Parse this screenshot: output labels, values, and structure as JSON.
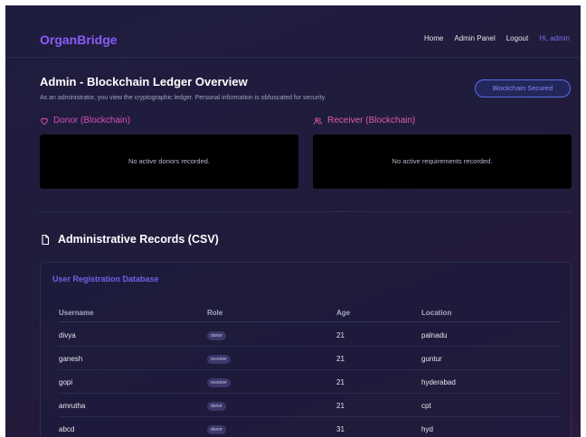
{
  "nav": {
    "brand": "OrganBridge",
    "links": [
      "Home",
      "Admin Panel",
      "Logout"
    ],
    "greeting": "Hi, admin"
  },
  "header": {
    "title": "Admin - Blockchain Ledger Overview",
    "subtitle": "As an administrator, you view the cryptographic ledger. Personal information is obfuscated for security.",
    "badge": "Blockchain Secured"
  },
  "donor": {
    "title": "Donor (Blockchain)",
    "empty": "No active donors recorded."
  },
  "receiver": {
    "title": "Receiver (Blockchain)",
    "empty": "No active requirements recorded."
  },
  "records": {
    "title": "Administrative Records (CSV)",
    "card_title": "User Registration Database",
    "columns": [
      "Username",
      "Role",
      "Age",
      "Location"
    ],
    "rows": [
      [
        "divya",
        "donor",
        "21",
        "palnadu"
      ],
      [
        "ganesh",
        "receiver",
        "21",
        "guntur"
      ],
      [
        "gopi",
        "receiver",
        "21",
        "hyderabad"
      ],
      [
        "amrutha",
        "donor",
        "21",
        "cpt"
      ],
      [
        "abcd",
        "donor",
        "31",
        "hyd"
      ]
    ]
  },
  "colors": {
    "brand": "#8b5cf6",
    "donor_accent": "#d84fb8",
    "receiver_accent": "#e05aa8",
    "background": "#1f1d3f"
  },
  "icons": {
    "donor": "heart-icon",
    "receiver": "users-icon",
    "records": "file-icon"
  }
}
